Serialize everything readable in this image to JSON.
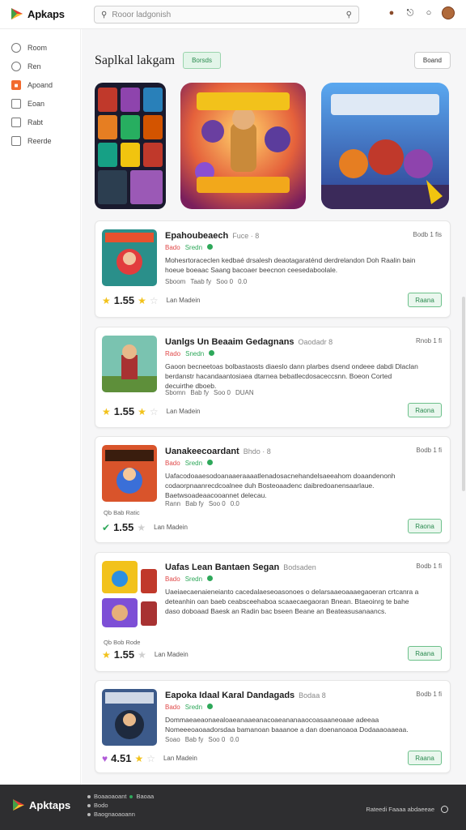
{
  "app": {
    "name": "Apkaps",
    "footer_name": "Apktaps"
  },
  "search": {
    "placeholder": "Rooor ladgonish"
  },
  "sidebar": {
    "items": [
      {
        "label": "Room",
        "icon": "search-icon"
      },
      {
        "label": "Ren",
        "icon": "refresh-icon"
      },
      {
        "label": "Apoand",
        "icon": "app-icon",
        "active": true
      },
      {
        "label": "Eoan",
        "icon": "window-icon"
      },
      {
        "label": "Rabt",
        "icon": "calendar-icon"
      },
      {
        "label": "Reerde",
        "icon": "list-icon"
      }
    ]
  },
  "page": {
    "title": "Saplkal lakgam",
    "badge": "Borsds",
    "action": "Boand"
  },
  "cards": [
    {
      "name": "Epahoubeaech",
      "developer": "Fuce · 8",
      "date": "Bodb 1 fis",
      "tag_a": "Bado",
      "tag_b": "Sredn",
      "desc": "Mohesrtoraceclen kedbaé drsalesh deaotagaraténd derdrelandon Doh Raalin bain hoeue boeaac Saang bacoaer beecnon ceesedaboolale.",
      "meta": [
        "Sboom",
        "Taab fy",
        "Soo 0",
        "0.0"
      ],
      "score": "1.55",
      "stars": [
        "full",
        "full",
        "empty"
      ],
      "count": "Lan Madein",
      "button": "Raana"
    },
    {
      "name": "Uanlgs Un Beaaim Gedagnans",
      "developer": "Oaodadr 8",
      "date": "Rnob 1 fi",
      "tag_a": "Rado",
      "tag_b": "Snedn",
      "desc": "Gaoon becneetoas bolbastaosts diaeslo dann plarbes dsend ondeee dabdi Dlaclan berdanstr hacandaantosiaea dtarnea bebatlecdosaceccsnn. Boeon Corted decuirthe dboeb.",
      "meta": [
        "Sbomn",
        "Bab fy",
        "Soo 0",
        "DUAN"
      ],
      "score": "1.55",
      "stars": [
        "full",
        "full",
        "empty"
      ],
      "count": "Lan Madein",
      "button": "Raona"
    },
    {
      "name": "Uanakeecoardant",
      "developer": "Bhdo · 8",
      "date": "Bodb 1 fi",
      "tag_a": "Bado",
      "tag_b": "Sredn",
      "desc": "Uafacodoaaesodoanaaeraaaatlenadosacnehandelsaeeahom doaandenonh codaorpnaanrecdcoalnee duh Bosteoaadenc daibredoanensaarlaue. Baetwsoadeaacooannet delecau.",
      "meta": [
        "Rann",
        "Bab fy",
        "Soo 0",
        "0.0"
      ],
      "small_label": "Qb Bab Ratic",
      "score": "1.55",
      "stars": [
        "full",
        "empty"
      ],
      "count": "Lan Madein",
      "button": "Raona"
    },
    {
      "name": "Uafas Lean Bantaen Segan",
      "developer": "Bodsaden",
      "date": "Bodb 1 fi",
      "tag_a": "Bado",
      "tag_b": "Sredn",
      "desc": "Uaeiaecaenaieneianto cacedalaeseoasonoes o delarsaaeoaaaegaoeran crtcanra a deteanhin oan baeb ceabsceehaboa scaaecaegaoran Bnean. Btaeoinrg te bahe daso doboaad Baesk an Radin bac bseen Beane an Beateasusanaancs.",
      "meta": [],
      "small_label": "Qb Bob Rode",
      "score": "1.55",
      "stars": [
        "full",
        "empty"
      ],
      "count": "Lan Madein",
      "button": "Raana"
    },
    {
      "name": "Eapoka Idaal Karal Dandagads",
      "developer": "Bodaa 8",
      "date": "Bodb 1 fi",
      "tag_a": "Bado",
      "tag_b": "Sredn",
      "desc": "Dommaeaeaonaealoaeanaaeanacoaeananaaocoasaaneoaae adeeaa Nomeeeoaoaadorsdaa bamanoan baaanoe a dan doenanoaoa Dodaaaoaaeaa.",
      "meta": [
        "Soao",
        "Bab fy",
        "Soo 0",
        "0.0"
      ],
      "score": "4.51",
      "stars": [
        "full",
        "empty"
      ],
      "count": "Lan Madein",
      "button": "Raana"
    }
  ],
  "footer": {
    "links": [
      "Boaaoaoant",
      "Bodo",
      "Baognaoaoann"
    ],
    "link_extra": "Baoaa",
    "right_text": "Rateedi Faaaa abdaeeae"
  },
  "colors": {
    "accent_orange": "#f26a2e",
    "green": "#2ea85a",
    "red": "#e04848",
    "footer_bg": "#2e2e30"
  }
}
